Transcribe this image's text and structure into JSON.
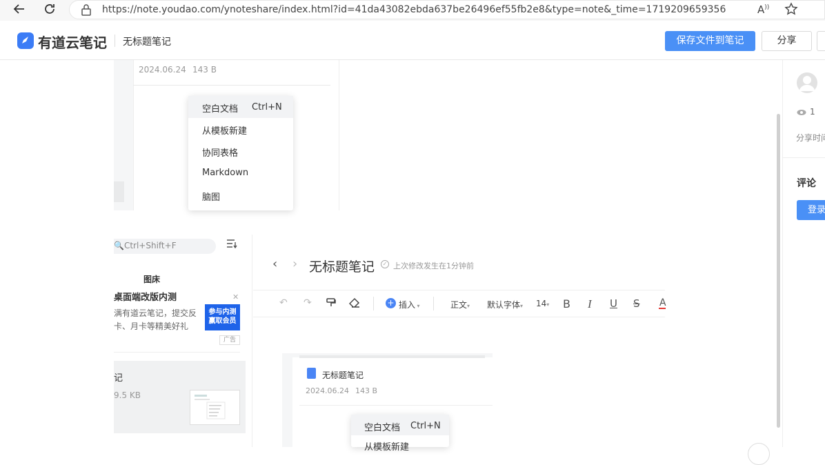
{
  "browser": {
    "url": "https://note.youdao.com/ynoteshare/index.html?id=41da43082ebda637be26496ef55fb2e8&type=note&_time=1719209659356",
    "icons": [
      "back-arrow-icon",
      "reload-icon",
      "lock-icon",
      "read-aloud-icon",
      "favorite-star-icon"
    ]
  },
  "header": {
    "app_name": "有道云笔记",
    "doc_title": "无标题笔记",
    "save_label": "保存文件到笔记",
    "share_label": "分享"
  },
  "sidebar": {
    "views": "1",
    "share_time": "分享时间",
    "comments_title": "评论",
    "login_label": "登录"
  },
  "screenshot_top": {
    "date": "2024.06.24",
    "size": "143 B",
    "menu": [
      {
        "label": "空白文档",
        "shortcut": "Ctrl+N"
      },
      {
        "label": "从模板新建"
      },
      {
        "label": "协同表格"
      },
      {
        "label": "Markdown"
      },
      {
        "label": "脑图"
      }
    ]
  },
  "screenshot_bottom": {
    "left_panel": {
      "search_placeholder": "Ctrl+Shift+F",
      "gallery_title": "图床",
      "ad": {
        "title": "桌面端改版内测",
        "line1": "满有道云笔记，提交反",
        "line2": "卡、月卡等精美好礼",
        "image_text": "参与内测 赢取会员",
        "badge": "广告"
      },
      "note": {
        "title": "记",
        "size": "9.5 KB"
      }
    },
    "editor": {
      "title": "无标题笔记",
      "status": "上次修改发生在1分钟前",
      "toolbar": {
        "insert": "插入",
        "paragraph": "正文",
        "font": "默认字体",
        "font_size": "14",
        "bold": "B",
        "italic": "I",
        "underline": "U",
        "strike": "S",
        "color": "A"
      }
    },
    "preview": {
      "doc_title": "无标题笔记",
      "date": "2024.06.24",
      "size": "143 B",
      "menu": [
        {
          "label": "空白文档",
          "shortcut": "Ctrl+N"
        },
        {
          "label": "从模板新建"
        }
      ]
    }
  },
  "colors": {
    "accent": "#4a90f6",
    "brand": "#3b7cf6",
    "ad_blue": "#1e63e9"
  }
}
